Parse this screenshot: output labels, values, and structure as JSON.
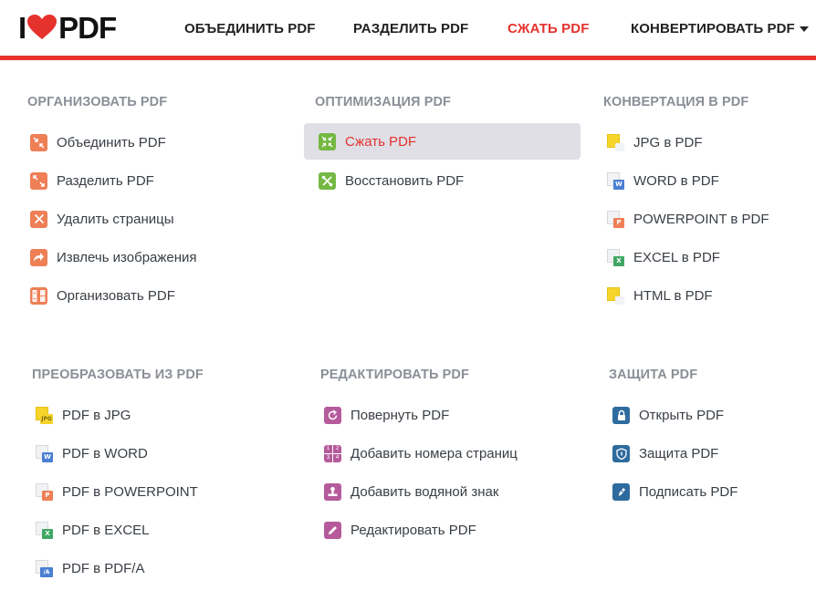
{
  "logo": {
    "left": "I",
    "right": "PDF"
  },
  "nav": [
    {
      "label": "ОБЪЕДИНИТЬ PDF"
    },
    {
      "label": "РАЗДЕЛИТЬ PDF"
    },
    {
      "label": "СЖАТЬ PDF",
      "active": true
    },
    {
      "label": "КОНВЕРТИРОВАТЬ PDF"
    }
  ],
  "colors": {
    "brand": "#e5322d",
    "highlight_bg": "#dfdfe5",
    "muted": "#8a8f97"
  },
  "sections": {
    "organize": {
      "title": "ОРГАНИЗОВАТЬ PDF",
      "items": [
        {
          "label": "Объединить PDF",
          "icon": "merge-icon"
        },
        {
          "label": "Разделить PDF",
          "icon": "split-icon"
        },
        {
          "label": "Удалить страницы",
          "icon": "remove-pages-icon"
        },
        {
          "label": "Извлечь изображения",
          "icon": "extract-images-icon"
        },
        {
          "label": "Организовать PDF",
          "icon": "organize-icon"
        }
      ]
    },
    "optimize": {
      "title": "ОПТИМИЗАЦИЯ PDF",
      "items": [
        {
          "label": "Сжать PDF",
          "icon": "compress-icon",
          "active": true
        },
        {
          "label": "Восстановить PDF",
          "icon": "repair-icon"
        }
      ]
    },
    "convert_to": {
      "title": "КОНВЕРТАЦИЯ В PDF",
      "items": [
        {
          "label": "JPG в PDF",
          "icon": "jpg-file-icon"
        },
        {
          "label": "WORD в PDF",
          "icon": "word-file-icon",
          "tag": "W"
        },
        {
          "label": "POWERPOINT в PDF",
          "icon": "powerpoint-file-icon",
          "tag": "P"
        },
        {
          "label": "EXCEL в PDF",
          "icon": "excel-file-icon",
          "tag": "X"
        },
        {
          "label": "HTML в PDF",
          "icon": "html-file-icon"
        }
      ]
    },
    "convert_from": {
      "title": "ПРЕОБРАЗОВАТЬ ИЗ PDF",
      "items": [
        {
          "label": "PDF в JPG",
          "icon": "pdf-to-jpg-icon",
          "tag": "JPG"
        },
        {
          "label": "PDF в WORD",
          "icon": "pdf-to-word-icon",
          "tag": "W"
        },
        {
          "label": "PDF в POWERPOINT",
          "icon": "pdf-to-powerpoint-icon",
          "tag": "P"
        },
        {
          "label": "PDF в EXCEL",
          "icon": "pdf-to-excel-icon",
          "tag": "X"
        },
        {
          "label": "PDF в PDF/A",
          "icon": "pdf-to-pdfa-icon",
          "tag": "/A"
        }
      ]
    },
    "edit": {
      "title": "РЕДАКТИРОВАТЬ PDF",
      "items": [
        {
          "label": "Повернуть PDF",
          "icon": "rotate-icon"
        },
        {
          "label": "Добавить номера страниц",
          "icon": "page-numbers-icon"
        },
        {
          "label": "Добавить водяной знак",
          "icon": "watermark-icon"
        },
        {
          "label": "Редактировать PDF",
          "icon": "edit-pencil-icon"
        }
      ]
    },
    "security": {
      "title": "ЗАЩИТА PDF",
      "items": [
        {
          "label": "Открыть PDF",
          "icon": "unlock-icon"
        },
        {
          "label": "Защита PDF",
          "icon": "shield-icon"
        },
        {
          "label": "Подписать PDF",
          "icon": "sign-pen-icon"
        }
      ]
    }
  }
}
